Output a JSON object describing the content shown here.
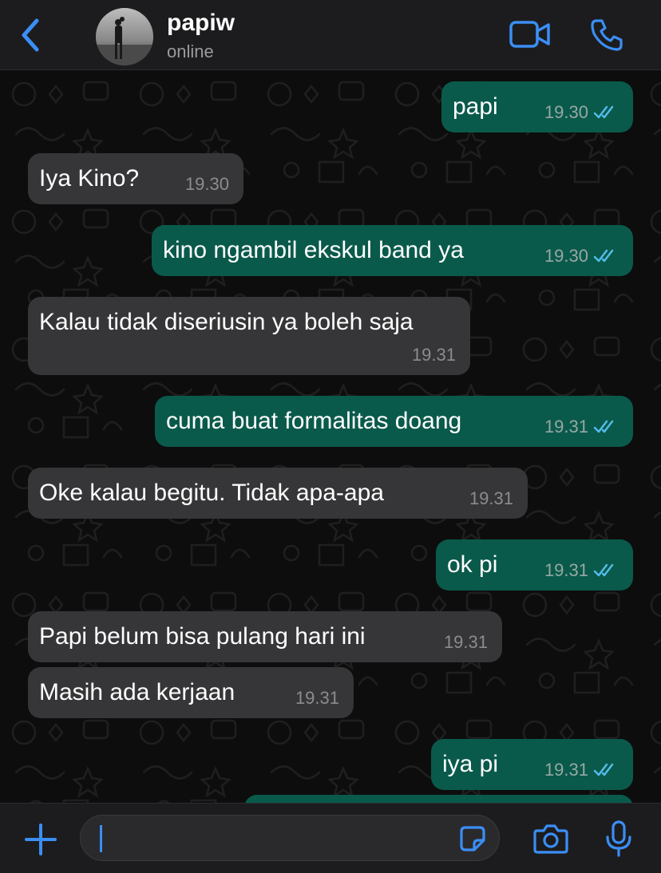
{
  "header": {
    "contact_name": "papiw",
    "status": "online",
    "back_icon": "chevron-left-icon",
    "video_icon": "video-camera-icon",
    "call_icon": "phone-icon"
  },
  "messages": [
    {
      "dir": "out",
      "text": "papi",
      "time": "19.30",
      "read": true
    },
    {
      "dir": "in",
      "text": "Iya Kino?",
      "time": "19.30"
    },
    {
      "dir": "out",
      "text": "kino ngambil ekskul band ya",
      "time": "19.30",
      "read": true
    },
    {
      "dir": "in",
      "text": "Kalau tidak diseriusin ya boleh saja",
      "time": "19.31"
    },
    {
      "dir": "out",
      "text": "cuma buat formalitas doang",
      "time": "19.31",
      "read": true
    },
    {
      "dir": "in",
      "text": "Oke kalau begitu. Tidak apa-apa",
      "time": "19.31"
    },
    {
      "dir": "out",
      "text": "ok pi",
      "time": "19.31",
      "read": true
    },
    {
      "dir": "in",
      "text": "Papi belum bisa pulang hari ini",
      "time": "19.31"
    },
    {
      "dir": "in",
      "text": "Masih ada kerjaan",
      "time": "19.31"
    },
    {
      "dir": "out",
      "text": "iya pi",
      "time": "19.31",
      "read": true
    }
  ],
  "composer": {
    "value": "",
    "plus_icon": "plus-icon",
    "sticker_icon": "sticker-icon",
    "camera_icon": "camera-icon",
    "mic_icon": "microphone-icon"
  },
  "colors": {
    "accent": "#3b8ef5",
    "outgoing_bubble": "#0a5a4b",
    "incoming_bubble": "#363638",
    "read_ticks": "#53bdeb"
  }
}
